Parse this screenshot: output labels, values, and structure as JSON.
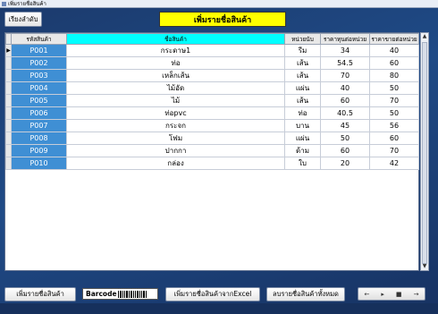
{
  "window": {
    "title": "เพิ่มรายชื่อสินค้า"
  },
  "toolbar": {
    "sort_label": "เรียงลำดับ"
  },
  "header": {
    "title": "เพิ่มรายชื่อสินค้า"
  },
  "table": {
    "columns": [
      "รหัสสินค้า",
      "ชื่อสินค้า",
      "หน่วยนับ",
      "ราคาทุนต่อหน่วย",
      "ราคาขายต่อหน่วย"
    ],
    "rows": [
      [
        "P001",
        "กระดาษ1",
        "รีม",
        "34",
        "40"
      ],
      [
        "P002",
        "ท่อ",
        "เส้น",
        "54.5",
        "60"
      ],
      [
        "P003",
        "เหล็กเส้น",
        "เส้น",
        "70",
        "80"
      ],
      [
        "P004",
        "ไม้อัด",
        "แผ่น",
        "40",
        "50"
      ],
      [
        "P005",
        "ไม้",
        "เส้น",
        "60",
        "70"
      ],
      [
        "P006",
        "ท่อpvc",
        "ท่อ",
        "40.5",
        "50"
      ],
      [
        "P007",
        "กระจก",
        "บาน",
        "45",
        "56"
      ],
      [
        "P008",
        "โฟม",
        "แผ่น",
        "50",
        "60"
      ],
      [
        "P009",
        "ปากกา",
        "ด้าม",
        "60",
        "70"
      ],
      [
        "P010",
        "กล่อง",
        "ใบ",
        "20",
        "42"
      ]
    ]
  },
  "bottom": {
    "add_label": "เพิ่มรายชื่อสินค้า",
    "barcode_label": "Barcode",
    "import_excel_label": "เพิ่มรายชื่อสินค้าจากExcel",
    "delete_all_label": "ลบรายชื่อสินค้าทั้งหมด",
    "nav": {
      "prev": "←",
      "play": "▸",
      "stop": "■",
      "next": "→"
    }
  }
}
